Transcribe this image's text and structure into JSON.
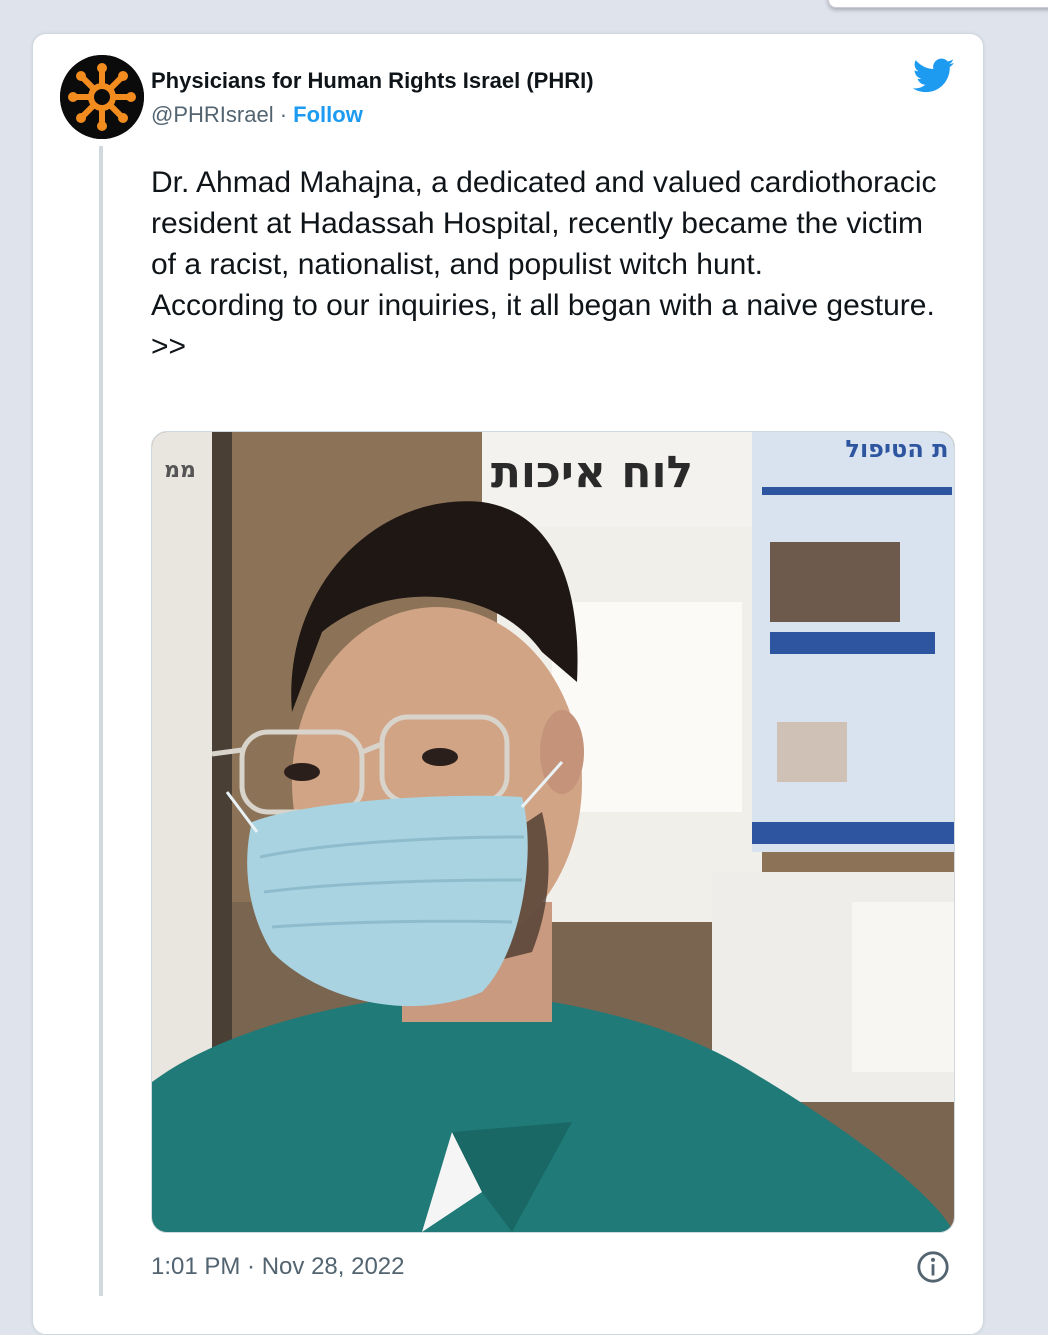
{
  "tweet": {
    "author_name": "Physicians for Human Rights Israel (PHRI)",
    "handle": "@PHRIsrael",
    "separator": " · ",
    "follow_label": "Follow",
    "text_lines": [
      "Dr. Ahmad Mahajna, a dedicated and valued cardiothoracic resident at Hadassah Hospital, recently became the victim of a racist, nationalist, and populist witch hunt.",
      "According to our inquiries, it all began with a naive gesture. >>"
    ],
    "time": "1:01 PM",
    "date": "Nov 28, 2022"
  },
  "photo": {
    "sign_text": "לוח איכות",
    "poster_text": "ת הטיפול",
    "edge_text": "ממ"
  },
  "icons": {
    "avatar": "phri-logo-icon",
    "platform": "twitter-bird-icon",
    "info": "info-icon"
  },
  "colors": {
    "accent": "#1d9bf0",
    "logo_orange": "#f28c1f",
    "scrubs": "#1f7a78",
    "mask": "#a9d3e0"
  }
}
